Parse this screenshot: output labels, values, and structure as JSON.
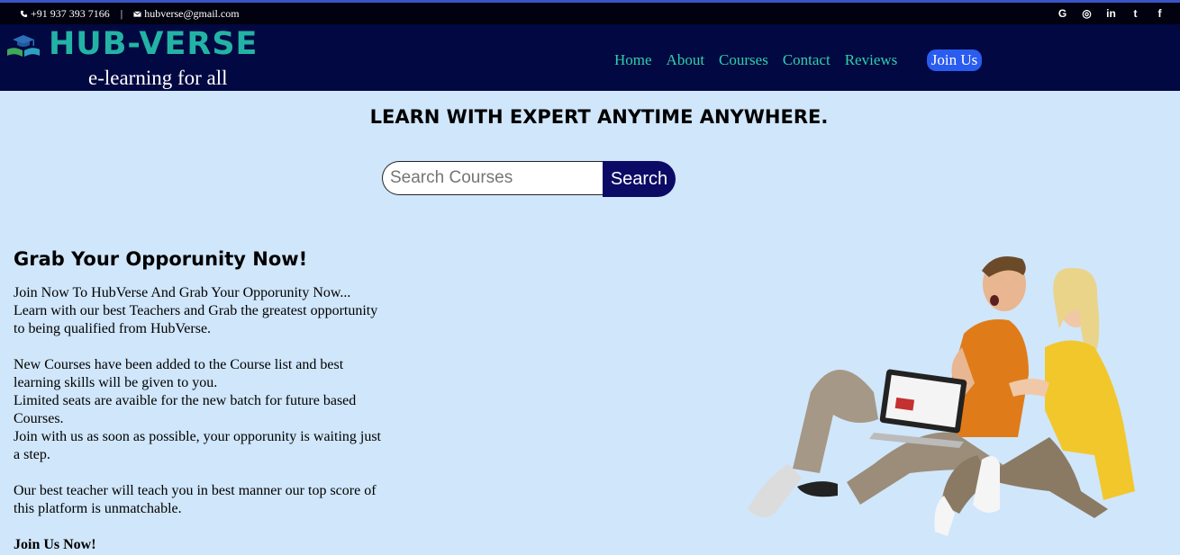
{
  "topbar": {
    "phone": "+91 937 393 7166",
    "separator": "|",
    "email": "hubverse@gmail.com",
    "socials": [
      {
        "icon": "google-icon",
        "glyph": "G"
      },
      {
        "icon": "instagram-icon",
        "glyph": "◎"
      },
      {
        "icon": "linkedin-icon",
        "glyph": "in"
      },
      {
        "icon": "twitter-icon",
        "glyph": "t"
      },
      {
        "icon": "facebook-icon",
        "glyph": "f"
      }
    ]
  },
  "brand": {
    "name": "HUB-VERSE",
    "tagline": "e-learning for all",
    "logo_icon": "graduation-book-icon"
  },
  "nav": {
    "items": [
      "Home",
      "About",
      "Courses",
      "Contact",
      "Reviews"
    ],
    "join_label": "Join Us"
  },
  "hero": {
    "title": "LEARN WITH EXPERT ANYTIME ANYWHERE.",
    "search_placeholder": "Search Courses",
    "search_button": "Search"
  },
  "opportunity": {
    "title": "Grab Your Opporunity Now!",
    "p1": "Join Now To HubVerse And Grab Your Opporunity Now... Learn with our best Teachers and Grab the greatest opportunity to being qualified from HubVerse.",
    "p2": "New Courses have been added to the Course list and best learning skills will be given to you.",
    "p3": "Limited seats are avaible for the new batch for future based Courses.",
    "p4": "Join with us as soon as possible, your opporunity is waiting just a step.",
    "p5": "Our best teacher will teach you in best manner our top score of this platform is unmatchable.",
    "cta": "Join Us Now!"
  },
  "colors": {
    "page_bg": "#d0e6fa",
    "header_bg": "#020842",
    "brand": "#23b3a4",
    "nav_link": "#2ed0a8",
    "join_button": "#2a5cf0",
    "search_button": "#0b0b66"
  }
}
